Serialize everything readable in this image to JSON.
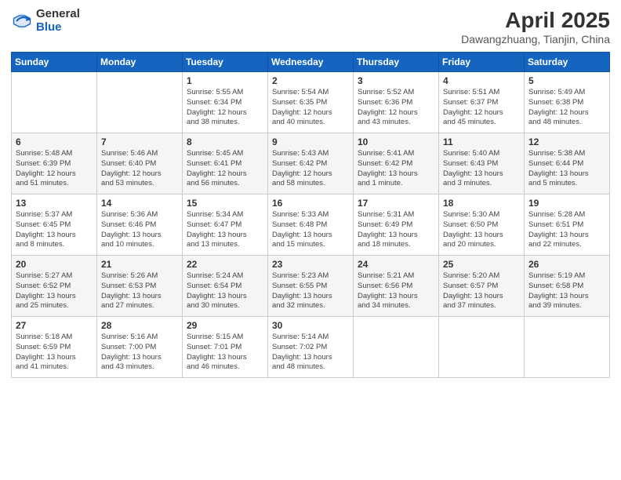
{
  "header": {
    "logo_general": "General",
    "logo_blue": "Blue",
    "title": "April 2025",
    "location": "Dawangzhuang, Tianjin, China"
  },
  "weekdays": [
    "Sunday",
    "Monday",
    "Tuesday",
    "Wednesday",
    "Thursday",
    "Friday",
    "Saturday"
  ],
  "weeks": [
    [
      {
        "day": "",
        "info": ""
      },
      {
        "day": "",
        "info": ""
      },
      {
        "day": "1",
        "info": "Sunrise: 5:55 AM\nSunset: 6:34 PM\nDaylight: 12 hours\nand 38 minutes."
      },
      {
        "day": "2",
        "info": "Sunrise: 5:54 AM\nSunset: 6:35 PM\nDaylight: 12 hours\nand 40 minutes."
      },
      {
        "day": "3",
        "info": "Sunrise: 5:52 AM\nSunset: 6:36 PM\nDaylight: 12 hours\nand 43 minutes."
      },
      {
        "day": "4",
        "info": "Sunrise: 5:51 AM\nSunset: 6:37 PM\nDaylight: 12 hours\nand 45 minutes."
      },
      {
        "day": "5",
        "info": "Sunrise: 5:49 AM\nSunset: 6:38 PM\nDaylight: 12 hours\nand 48 minutes."
      }
    ],
    [
      {
        "day": "6",
        "info": "Sunrise: 5:48 AM\nSunset: 6:39 PM\nDaylight: 12 hours\nand 51 minutes."
      },
      {
        "day": "7",
        "info": "Sunrise: 5:46 AM\nSunset: 6:40 PM\nDaylight: 12 hours\nand 53 minutes."
      },
      {
        "day": "8",
        "info": "Sunrise: 5:45 AM\nSunset: 6:41 PM\nDaylight: 12 hours\nand 56 minutes."
      },
      {
        "day": "9",
        "info": "Sunrise: 5:43 AM\nSunset: 6:42 PM\nDaylight: 12 hours\nand 58 minutes."
      },
      {
        "day": "10",
        "info": "Sunrise: 5:41 AM\nSunset: 6:42 PM\nDaylight: 13 hours\nand 1 minute."
      },
      {
        "day": "11",
        "info": "Sunrise: 5:40 AM\nSunset: 6:43 PM\nDaylight: 13 hours\nand 3 minutes."
      },
      {
        "day": "12",
        "info": "Sunrise: 5:38 AM\nSunset: 6:44 PM\nDaylight: 13 hours\nand 5 minutes."
      }
    ],
    [
      {
        "day": "13",
        "info": "Sunrise: 5:37 AM\nSunset: 6:45 PM\nDaylight: 13 hours\nand 8 minutes."
      },
      {
        "day": "14",
        "info": "Sunrise: 5:36 AM\nSunset: 6:46 PM\nDaylight: 13 hours\nand 10 minutes."
      },
      {
        "day": "15",
        "info": "Sunrise: 5:34 AM\nSunset: 6:47 PM\nDaylight: 13 hours\nand 13 minutes."
      },
      {
        "day": "16",
        "info": "Sunrise: 5:33 AM\nSunset: 6:48 PM\nDaylight: 13 hours\nand 15 minutes."
      },
      {
        "day": "17",
        "info": "Sunrise: 5:31 AM\nSunset: 6:49 PM\nDaylight: 13 hours\nand 18 minutes."
      },
      {
        "day": "18",
        "info": "Sunrise: 5:30 AM\nSunset: 6:50 PM\nDaylight: 13 hours\nand 20 minutes."
      },
      {
        "day": "19",
        "info": "Sunrise: 5:28 AM\nSunset: 6:51 PM\nDaylight: 13 hours\nand 22 minutes."
      }
    ],
    [
      {
        "day": "20",
        "info": "Sunrise: 5:27 AM\nSunset: 6:52 PM\nDaylight: 13 hours\nand 25 minutes."
      },
      {
        "day": "21",
        "info": "Sunrise: 5:26 AM\nSunset: 6:53 PM\nDaylight: 13 hours\nand 27 minutes."
      },
      {
        "day": "22",
        "info": "Sunrise: 5:24 AM\nSunset: 6:54 PM\nDaylight: 13 hours\nand 30 minutes."
      },
      {
        "day": "23",
        "info": "Sunrise: 5:23 AM\nSunset: 6:55 PM\nDaylight: 13 hours\nand 32 minutes."
      },
      {
        "day": "24",
        "info": "Sunrise: 5:21 AM\nSunset: 6:56 PM\nDaylight: 13 hours\nand 34 minutes."
      },
      {
        "day": "25",
        "info": "Sunrise: 5:20 AM\nSunset: 6:57 PM\nDaylight: 13 hours\nand 37 minutes."
      },
      {
        "day": "26",
        "info": "Sunrise: 5:19 AM\nSunset: 6:58 PM\nDaylight: 13 hours\nand 39 minutes."
      }
    ],
    [
      {
        "day": "27",
        "info": "Sunrise: 5:18 AM\nSunset: 6:59 PM\nDaylight: 13 hours\nand 41 minutes."
      },
      {
        "day": "28",
        "info": "Sunrise: 5:16 AM\nSunset: 7:00 PM\nDaylight: 13 hours\nand 43 minutes."
      },
      {
        "day": "29",
        "info": "Sunrise: 5:15 AM\nSunset: 7:01 PM\nDaylight: 13 hours\nand 46 minutes."
      },
      {
        "day": "30",
        "info": "Sunrise: 5:14 AM\nSunset: 7:02 PM\nDaylight: 13 hours\nand 48 minutes."
      },
      {
        "day": "",
        "info": ""
      },
      {
        "day": "",
        "info": ""
      },
      {
        "day": "",
        "info": ""
      }
    ]
  ]
}
